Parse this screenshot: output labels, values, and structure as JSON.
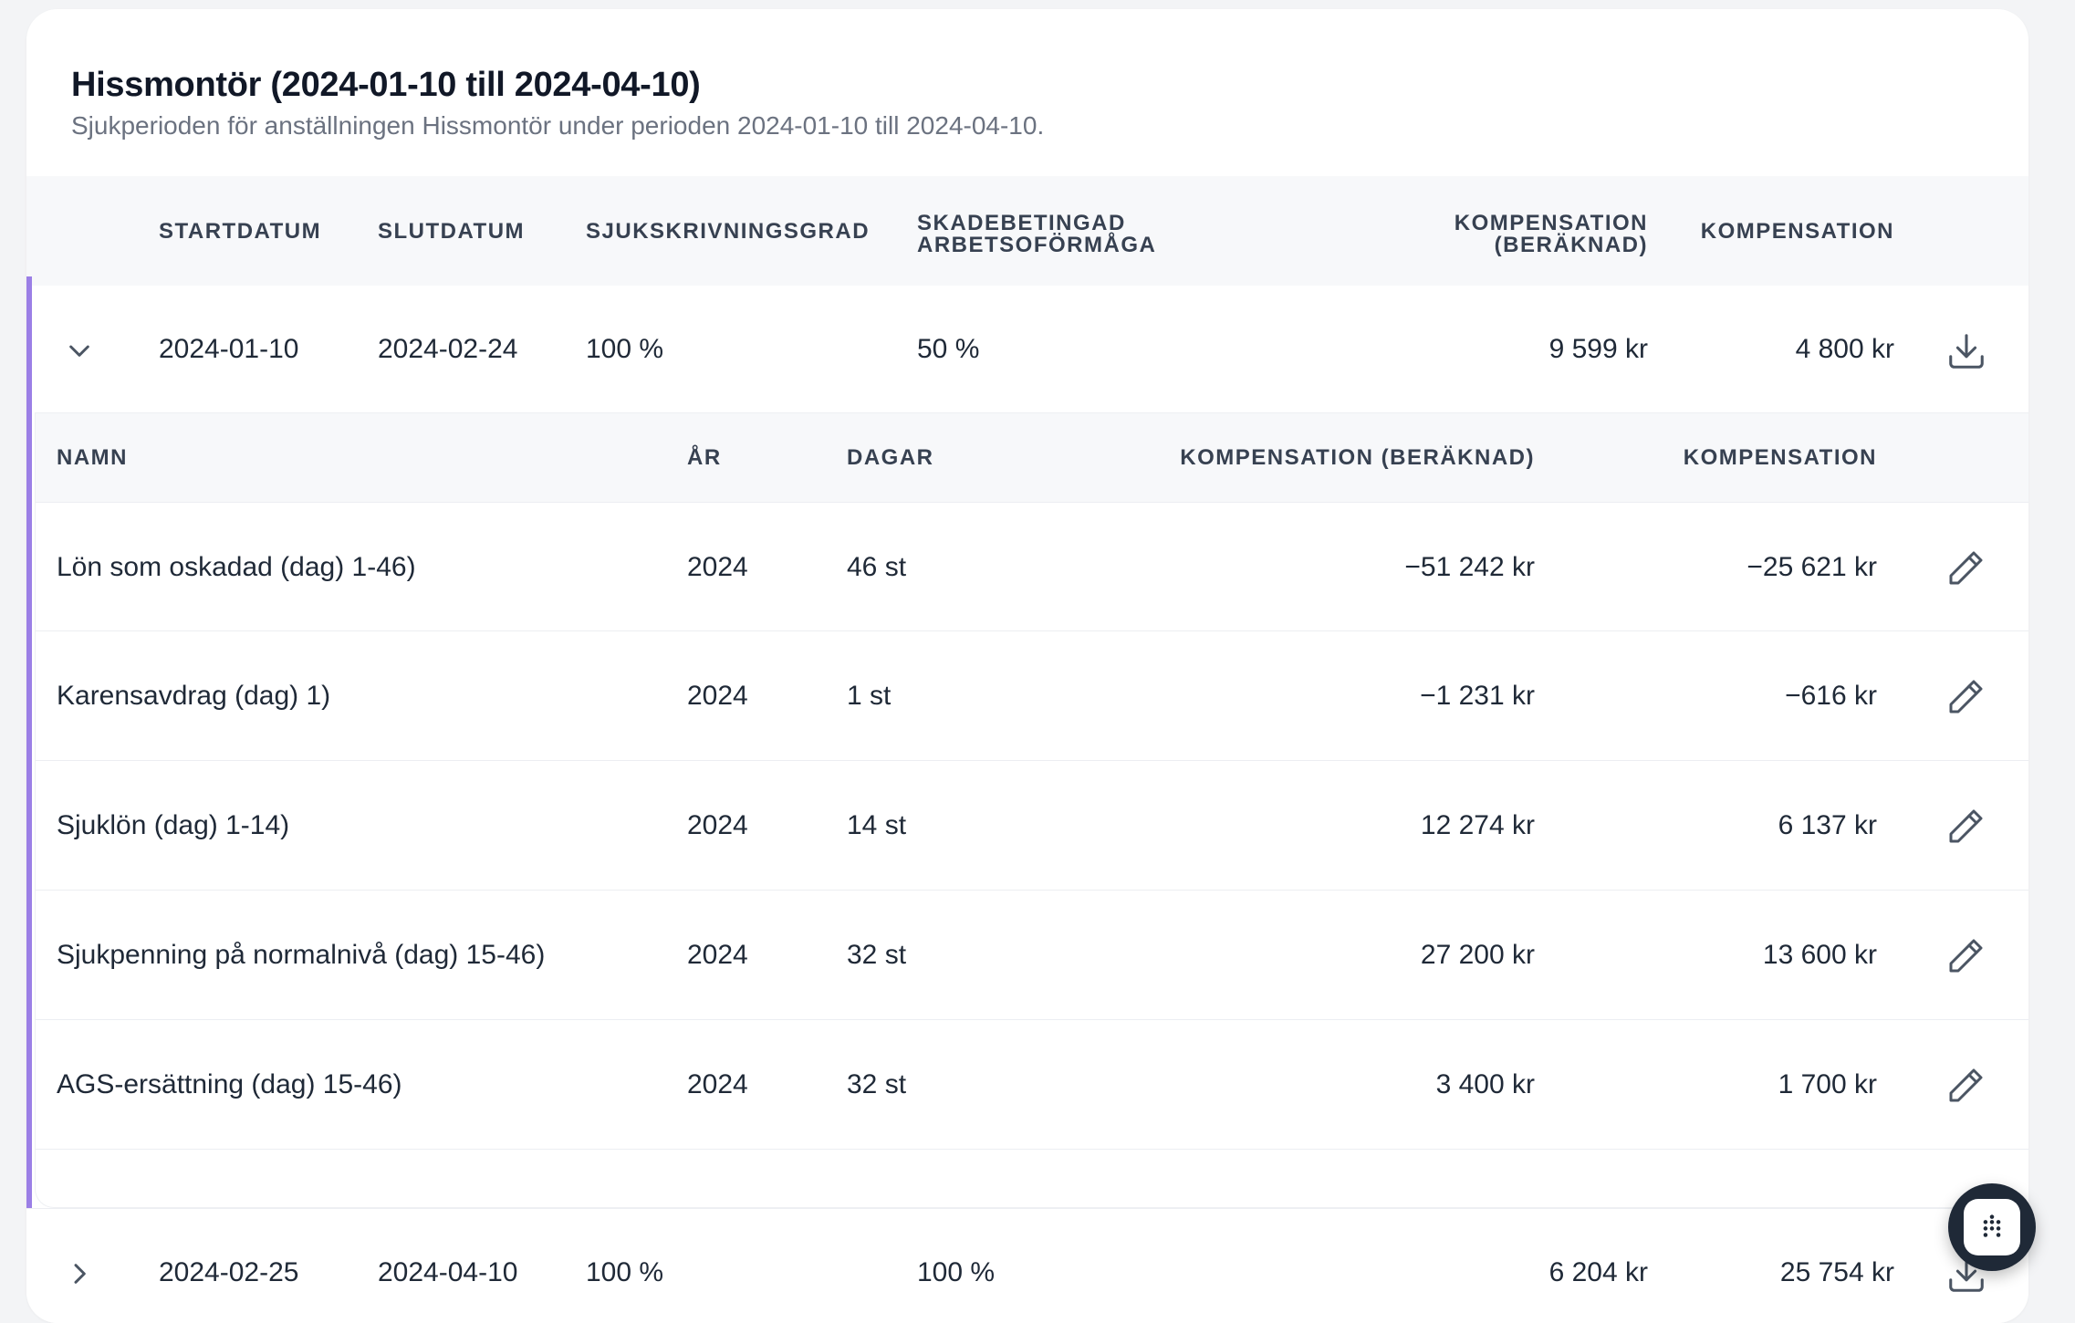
{
  "section": {
    "title": "Hissmontör (2024-01-10 till 2024-04-10)",
    "subtitle": "Sjukperioden för anställningen Hissmontör under perioden 2024-01-10 till 2024-04-10."
  },
  "main_table": {
    "headers": {
      "start": "STARTDATUM",
      "end": "SLUTDATUM",
      "degree": "SJUKSKRIVNINGSGRAD",
      "impair_line1": "SKADEBETINGAD",
      "impair_line2": "ARBETSOFÖRMÅGA",
      "comp_calc_line1": "KOMPENSATION",
      "comp_calc_line2": "(BERÄKNAD)",
      "comp": "KOMPENSATION"
    },
    "rows": [
      {
        "expanded": true,
        "start": "2024-01-10",
        "end": "2024-02-24",
        "degree": "100 %",
        "impairment": "50 %",
        "comp_calc": "9 599 kr",
        "comp": "4 800 kr"
      },
      {
        "expanded": false,
        "start": "2024-02-25",
        "end": "2024-04-10",
        "degree": "100 %",
        "impairment": "100 %",
        "comp_calc": "6 204 kr",
        "comp": "25 754 kr"
      }
    ]
  },
  "sub_table": {
    "headers": {
      "name": "NAMN",
      "year": "ÅR",
      "days": "DAGAR",
      "comp_calc": "KOMPENSATION (BERÄKNAD)",
      "comp": "KOMPENSATION"
    },
    "rows": [
      {
        "name": "Lön som oskadad (dag) 1-46)",
        "year": "2024",
        "days": "46 st",
        "comp_calc": "−51 242 kr",
        "comp": "−25 621 kr"
      },
      {
        "name": "Karensavdrag (dag) 1)",
        "year": "2024",
        "days": "1 st",
        "comp_calc": "−1 231 kr",
        "comp": "−616 kr"
      },
      {
        "name": "Sjuklön (dag) 1-14)",
        "year": "2024",
        "days": "14 st",
        "comp_calc": "12 274 kr",
        "comp": "6 137 kr"
      },
      {
        "name": "Sjukpenning på normalnivå (dag) 15-46)",
        "year": "2024",
        "days": "32 st",
        "comp_calc": "27 200 kr",
        "comp": "13 600 kr"
      },
      {
        "name": "AGS-ersättning (dag) 15-46)",
        "year": "2024",
        "days": "32 st",
        "comp_calc": "3 400 kr",
        "comp": "1 700 kr"
      }
    ]
  },
  "colors": {
    "accent_bar": "#9b7fe6",
    "header_bg": "#f7f8fa",
    "fab_bg": "#1f2937"
  },
  "icons": {
    "expand": "chevron-down-icon",
    "collapse": "chevron-right-icon",
    "download": "download-icon",
    "edit": "pencil-icon",
    "fab": "dots-grid-icon"
  }
}
